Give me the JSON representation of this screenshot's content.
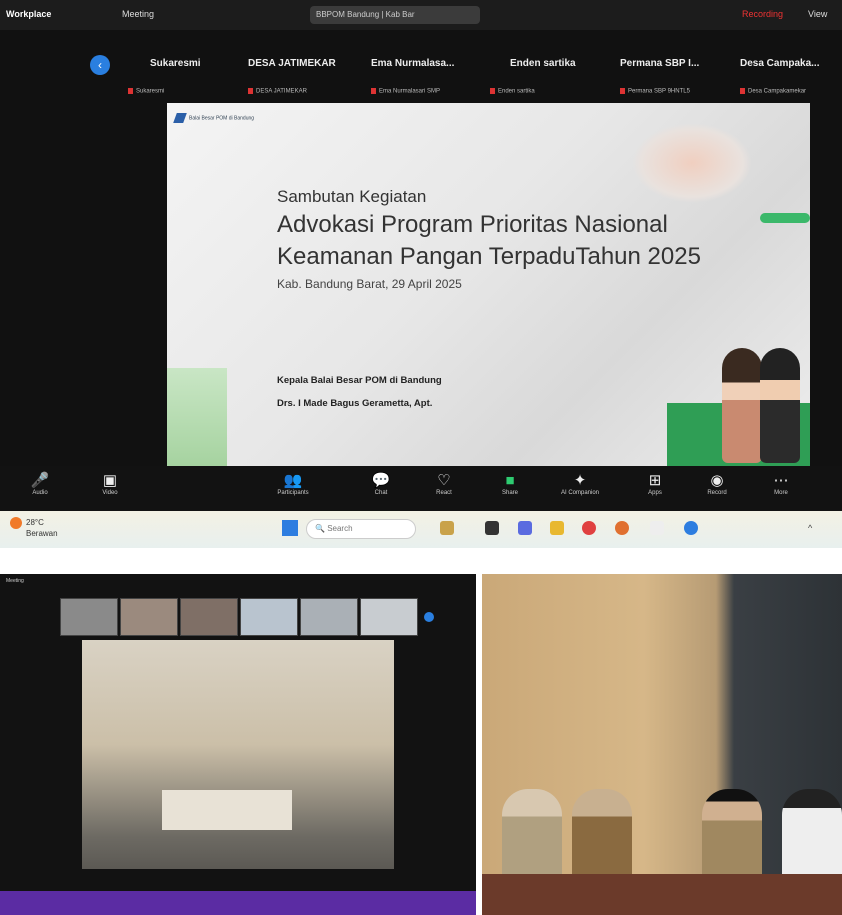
{
  "zoom_main": {
    "titlebar": {
      "app": "Workplace",
      "meeting": "Meeting",
      "tab": "BBPOM Bandung | Kab Bar",
      "recording": "Recording",
      "view": "View"
    },
    "participants": [
      {
        "name": "Sukaresmi",
        "sub": "Sukaresmi"
      },
      {
        "name": "DESA JATIMEKAR",
        "sub": "DESA JATIMEKAR"
      },
      {
        "name": "Ema Nurmalasa...",
        "sub": "Ema Nurmalasari SMP"
      },
      {
        "name": "Enden sartika",
        "sub": "Enden sartika"
      },
      {
        "name": "Permana SBP I...",
        "sub": "Permana SBP 9HNTL5"
      },
      {
        "name": "Desa Campaka...",
        "sub": "Desa Campakamekar"
      }
    ],
    "slide": {
      "logo_text": "Balai Besar POM di Bandung",
      "subtitle": "Sambutan Kegiatan",
      "title_line1": "Advokasi Program Prioritas Nasional",
      "title_line2": "Keamanan Pangan TerpaduTahun 2025",
      "date": "Kab. Bandung Barat, 29 April 2025",
      "presenter_role": "Kepala Balai Besar POM di Bandung",
      "presenter_name": "Drs. I Made Bagus Gerametta, Apt."
    },
    "toolbar": [
      {
        "label": "Audio",
        "icon": "microphone-icon"
      },
      {
        "label": "Video",
        "icon": "video-icon"
      },
      {
        "label": "Participants",
        "icon": "participants-icon"
      },
      {
        "label": "Chat",
        "icon": "chat-icon"
      },
      {
        "label": "React",
        "icon": "react-icon"
      },
      {
        "label": "Share",
        "icon": "share-icon"
      },
      {
        "label": "AI Companion",
        "icon": "ai-companion-icon"
      },
      {
        "label": "Apps",
        "icon": "apps-icon"
      },
      {
        "label": "Record",
        "icon": "record-icon"
      },
      {
        "label": "More",
        "icon": "more-icon"
      }
    ],
    "taskbar": {
      "weather": "28°C",
      "weather_sub": "Berawan",
      "search": "Search"
    }
  },
  "photo_left": {
    "title": "Meeting"
  },
  "colors": {
    "accent": "#2a7fe0",
    "green": "#3bb86a",
    "record": "#e33333",
    "taskbar_purple": "#5b2ca3"
  }
}
